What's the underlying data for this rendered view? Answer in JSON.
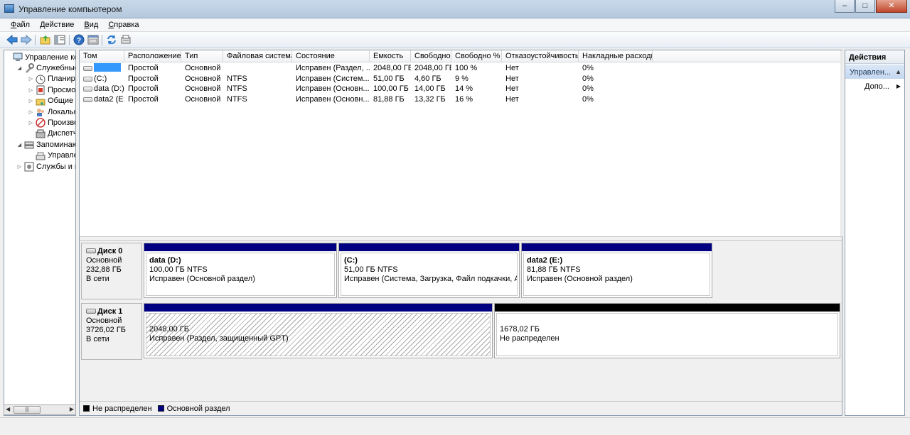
{
  "window": {
    "title": "Управление компьютером",
    "controls": {
      "minimize": "–",
      "maximize": "□",
      "close": "✕"
    }
  },
  "menu": [
    {
      "label": "Файл",
      "accel": "Ф",
      "rest": "айл"
    },
    {
      "label": "Действие",
      "accel": "Д",
      "rest": "ействие"
    },
    {
      "label": "Вид",
      "accel": "В",
      "rest": "ид"
    },
    {
      "label": "Справка",
      "accel": "С",
      "rest": "правка"
    }
  ],
  "toolbar": {
    "icons": [
      "back-arrow-icon",
      "forward-arrow-icon",
      "up-folder-icon",
      "show-hide-tree-icon",
      "help-icon",
      "properties-icon",
      "refresh-icon",
      "export-icon"
    ]
  },
  "tree": {
    "items": [
      {
        "label": "Управление компь",
        "level": 0,
        "expander": "",
        "icon": "computer-management-icon"
      },
      {
        "label": "Служебные п",
        "level": 1,
        "expander": "◢",
        "icon": "system-tools-icon"
      },
      {
        "label": "Планиро",
        "level": 2,
        "expander": "▷",
        "icon": "task-scheduler-icon"
      },
      {
        "label": "Просмот",
        "level": 2,
        "expander": "▷",
        "icon": "event-viewer-icon"
      },
      {
        "label": "Общие п",
        "level": 2,
        "expander": "▷",
        "icon": "shared-folders-icon"
      },
      {
        "label": "Локальн",
        "level": 2,
        "expander": "▷",
        "icon": "local-users-icon"
      },
      {
        "label": "Производ",
        "level": 2,
        "expander": "▷",
        "icon": "performance-icon"
      },
      {
        "label": "Диспетче",
        "level": 2,
        "expander": "",
        "icon": "device-manager-icon"
      },
      {
        "label": "Запоминаю",
        "level": 1,
        "expander": "◢",
        "icon": "storage-icon"
      },
      {
        "label": "Управлен",
        "level": 2,
        "expander": "",
        "icon": "disk-management-icon"
      },
      {
        "label": "Службы и пр",
        "level": 1,
        "expander": "▷",
        "icon": "services-icon"
      }
    ]
  },
  "volumes": {
    "columns": [
      "Том",
      "Расположение",
      "Тип",
      "Файловая система",
      "Состояние",
      "Емкость",
      "Свободно",
      "Свободно %",
      "Отказоустойчивость",
      "Накладные расходы"
    ],
    "rows": [
      {
        "name": "",
        "selected": true,
        "layout": "Простой",
        "type": "Основной",
        "fs": "",
        "status": "Исправен (Раздел, ...",
        "capacity": "2048,00 ГБ",
        "free": "2048,00 ГБ",
        "free_pct": "100 %",
        "fault": "Нет",
        "overhead": "0%"
      },
      {
        "name": "(C:)",
        "selected": false,
        "layout": "Простой",
        "type": "Основной",
        "fs": "NTFS",
        "status": "Исправен (Систем...",
        "capacity": "51,00 ГБ",
        "free": "4,60 ГБ",
        "free_pct": "9 %",
        "fault": "Нет",
        "overhead": "0%"
      },
      {
        "name": "data (D:)",
        "selected": false,
        "layout": "Простой",
        "type": "Основной",
        "fs": "NTFS",
        "status": "Исправен (Основн...",
        "capacity": "100,00 ГБ",
        "free": "14,00 ГБ",
        "free_pct": "14 %",
        "fault": "Нет",
        "overhead": "0%"
      },
      {
        "name": "data2 (E:)",
        "selected": false,
        "layout": "Простой",
        "type": "Основной",
        "fs": "NTFS",
        "status": "Исправен (Основн...",
        "capacity": "81,88 ГБ",
        "free": "13,32 ГБ",
        "free_pct": "16 %",
        "fault": "Нет",
        "overhead": "0%"
      }
    ]
  },
  "disks": [
    {
      "name": "Диск 0",
      "type": "Основной",
      "size": "232,88 ГБ",
      "state": "В сети",
      "partitions": [
        {
          "name": "data  (D:)",
          "size": "100,00 ГБ NTFS",
          "status": "Исправен (Основной раздел)",
          "bar_color": "#000080"
        },
        {
          "name": "(C:)",
          "size": "51,00 ГБ NTFS",
          "status": "Исправен (Система, Загрузка, Файл подкачки, Акти",
          "bar_color": "#000080"
        },
        {
          "name": "data2  (E:)",
          "size": "81,88 ГБ NTFS",
          "status": "Исправен (Основной раздел)",
          "bar_color": "#000080"
        }
      ]
    },
    {
      "name": "Диск 1",
      "type": "Основной",
      "size": "3726,02 ГБ",
      "state": "В сети",
      "partitions": [
        {
          "name": "",
          "size": "2048,00 ГБ",
          "status": "Исправен (Раздел, защищенный GPT)",
          "bar_color": "#000080",
          "hatched": true
        },
        {
          "name": "",
          "size": "1678,02 ГБ",
          "status": "Не распределен",
          "bar_color": "#000000"
        }
      ]
    }
  ],
  "legend": [
    {
      "label": "Не распределен",
      "color": "#000000"
    },
    {
      "label": "Основной раздел",
      "color": "#000080"
    }
  ],
  "actions": {
    "header": "Действия",
    "section": "Управлен...",
    "item": "Допо..."
  },
  "scrollbar": {
    "grip": "|||"
  }
}
